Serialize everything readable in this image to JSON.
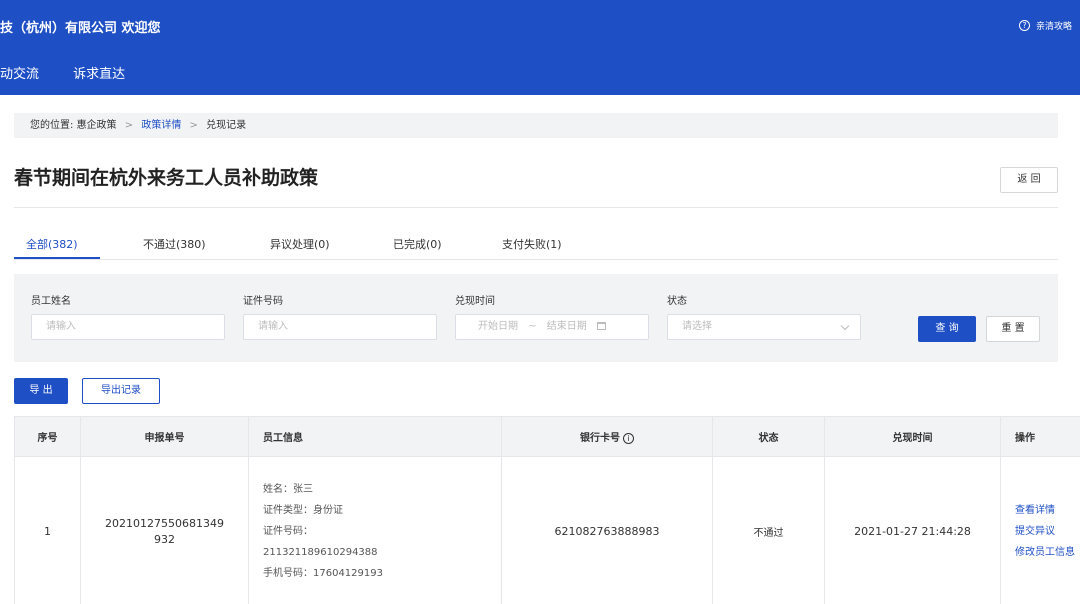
{
  "header": {
    "welcome": "技（杭州）有限公司 欢迎您",
    "help_label": "亲清攻略",
    "help_icon": "help-circle-icon",
    "nav": [
      "动交流",
      "诉求直达"
    ]
  },
  "breadcrumb": {
    "prefix": "您的位置:",
    "items": [
      "惠企政策",
      "政策详情",
      "兑现记录"
    ],
    "separator": ">"
  },
  "page": {
    "title": "春节期间在杭外来务工人员补助政策",
    "back_label": "返 回"
  },
  "tabs": [
    {
      "label": "全部(382)",
      "active": true
    },
    {
      "label": "不通过(380)",
      "active": false
    },
    {
      "label": "异议处理(0)",
      "active": false
    },
    {
      "label": "已完成(0)",
      "active": false
    },
    {
      "label": "支付失败(1)",
      "active": false
    }
  ],
  "filters": {
    "employee_name": {
      "label": "员工姓名",
      "placeholder": "请输入"
    },
    "id_number": {
      "label": "证件号码",
      "placeholder": "请输入"
    },
    "redeem_time": {
      "label": "兑现时间",
      "start_placeholder": "开始日期",
      "range_sep": "~",
      "end_placeholder": "结束日期"
    },
    "status": {
      "label": "状态",
      "placeholder": "请选择"
    },
    "query_label": "查 询",
    "reset_label": "重 置"
  },
  "actions": {
    "export_label": "导 出",
    "export_records_label": "导出记录"
  },
  "table": {
    "headers": [
      "序号",
      "申报单号",
      "员工信息",
      "银行卡号",
      "状态",
      "兑现时间",
      "操作"
    ],
    "bank_info_icon": "info-circle-icon",
    "rows": [
      {
        "index": "1",
        "order_no": "20210127550681349\n932",
        "employee": [
          "姓名：张三",
          "证件类型：身份证",
          "证件号码：",
          "211321189610294388",
          "手机号码：17604129193"
        ],
        "bank_card": "621082763888983",
        "status": "不通过",
        "time": "2021-01-27 21:44:28",
        "ops": [
          "查看详情",
          "提交异议",
          "修改员工信息"
        ]
      }
    ]
  },
  "colors": {
    "brand": "#1e4fc4",
    "panel": "#f2f3f5",
    "border": "#e5e7eb"
  }
}
